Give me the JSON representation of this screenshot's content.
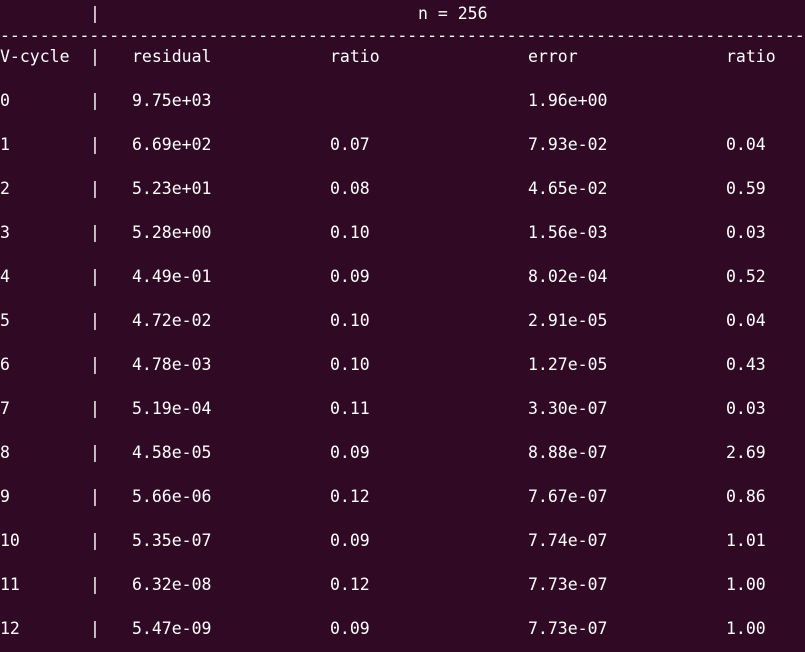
{
  "header": {
    "separator": "|",
    "title": "n = 256"
  },
  "divider": "------------------------------------------------------------------------------------------------",
  "columns": {
    "vcycle": "V-cycle",
    "separator": "|",
    "residual": "residual",
    "ratio1": "ratio",
    "error": "error",
    "ratio2": "ratio"
  },
  "rows": [
    {
      "cycle": "0",
      "sep": "|",
      "residual": "9.75e+03",
      "rratio": "",
      "error": "1.96e+00",
      "eratio": ""
    },
    {
      "cycle": "1",
      "sep": "|",
      "residual": "6.69e+02",
      "rratio": "0.07",
      "error": "7.93e-02",
      "eratio": "0.04"
    },
    {
      "cycle": "2",
      "sep": "|",
      "residual": "5.23e+01",
      "rratio": "0.08",
      "error": "4.65e-02",
      "eratio": "0.59"
    },
    {
      "cycle": "3",
      "sep": "|",
      "residual": "5.28e+00",
      "rratio": "0.10",
      "error": "1.56e-03",
      "eratio": "0.03"
    },
    {
      "cycle": "4",
      "sep": "|",
      "residual": "4.49e-01",
      "rratio": "0.09",
      "error": "8.02e-04",
      "eratio": "0.52"
    },
    {
      "cycle": "5",
      "sep": "|",
      "residual": "4.72e-02",
      "rratio": "0.10",
      "error": "2.91e-05",
      "eratio": "0.04"
    },
    {
      "cycle": "6",
      "sep": "|",
      "residual": "4.78e-03",
      "rratio": "0.10",
      "error": "1.27e-05",
      "eratio": "0.43"
    },
    {
      "cycle": "7",
      "sep": "|",
      "residual": "5.19e-04",
      "rratio": "0.11",
      "error": "3.30e-07",
      "eratio": "0.03"
    },
    {
      "cycle": "8",
      "sep": "|",
      "residual": "4.58e-05",
      "rratio": "0.09",
      "error": "8.88e-07",
      "eratio": "2.69"
    },
    {
      "cycle": "9",
      "sep": "|",
      "residual": "5.66e-06",
      "rratio": "0.12",
      "error": "7.67e-07",
      "eratio": "0.86"
    },
    {
      "cycle": "10",
      "sep": "|",
      "residual": "5.35e-07",
      "rratio": "0.09",
      "error": "7.74e-07",
      "eratio": "1.01"
    },
    {
      "cycle": "11",
      "sep": "|",
      "residual": "6.32e-08",
      "rratio": "0.12",
      "error": "7.73e-07",
      "eratio": "1.00"
    },
    {
      "cycle": "12",
      "sep": "|",
      "residual": "5.47e-09",
      "rratio": "0.09",
      "error": "7.73e-07",
      "eratio": "1.00"
    }
  ],
  "colors": {
    "background": "#300a24",
    "text": "#ffffff"
  }
}
